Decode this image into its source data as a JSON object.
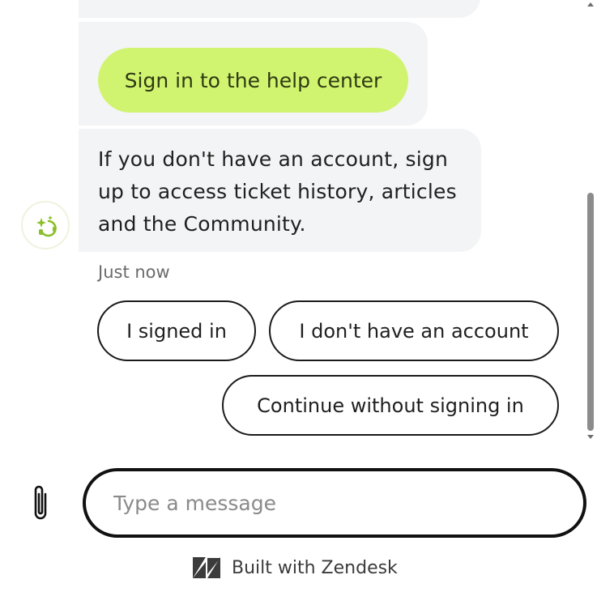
{
  "conversation": {
    "sign_in_button_label": "Sign in to the help center",
    "info_message": "If you don't have an account, sign up to access ticket history, articles and the Community.",
    "timestamp": "Just now",
    "quick_replies": [
      {
        "label": "I signed in"
      },
      {
        "label": "I don't have an account"
      },
      {
        "label": "Continue without signing in"
      }
    ]
  },
  "composer": {
    "placeholder": "Type a message",
    "value": "",
    "attach_icon": "paperclip-icon"
  },
  "footer": {
    "label": "Built with Zendesk",
    "logo_icon": "zendesk-logo-icon"
  },
  "colors": {
    "accent": "#d1f470",
    "bubble_background": "#f3f4f5",
    "avatar_icon": "#8bbf2a"
  }
}
